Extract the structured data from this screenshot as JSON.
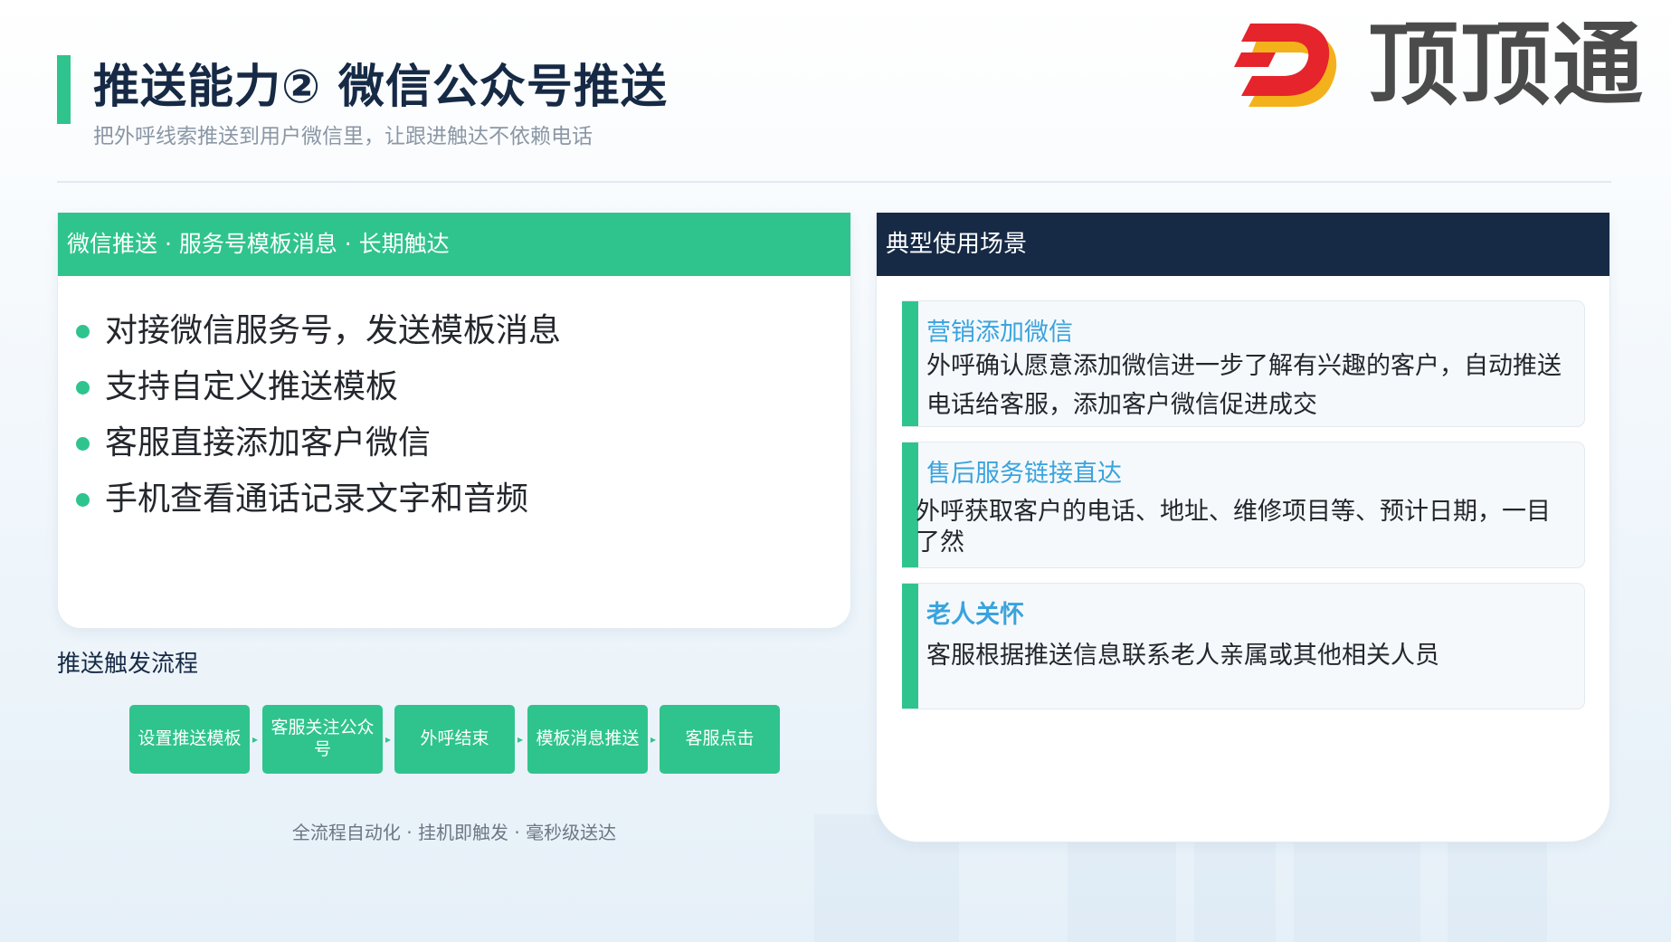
{
  "header": {
    "title": "推送能力② 微信公众号推送",
    "subtitle": "把外呼线索推送到用户微信里，让跟进触达不依赖电话"
  },
  "logo": {
    "text": "顶顶通",
    "icon": "dingdingtong-logo-icon",
    "colors": {
      "red": "#e5242b",
      "yellow": "#f3b21b",
      "text": "#4b4b4b"
    }
  },
  "left_panel": {
    "header": "微信推送 · 服务号模板消息 · 长期触达",
    "features": [
      "对接微信服务号，发送模板消息",
      "支持自定义推送模板",
      "客服直接添加客户微信",
      "手机查看通话记录文字和音频"
    ]
  },
  "flow": {
    "title": "推送触发流程",
    "steps": [
      "设置推送模板",
      "客服关注公众号",
      "外呼结束",
      "模板消息推送",
      "客服点击"
    ],
    "note": "全流程自动化 · 挂机即触发 · 毫秒级送达"
  },
  "right_panel": {
    "header": "典型使用场景",
    "scenarios": [
      {
        "title": "营销添加微信",
        "description": "外呼确认愿意添加微信进一步了解有兴趣的客户，自动推送电话给客服，添加客户微信促进成交"
      },
      {
        "title": "售后服务链接直达",
        "description": "外呼获取客户的电话、地址、维修项目等、预计日期，一目了然"
      },
      {
        "title": "老人关怀",
        "description": "客服根据推送信息联系老人亲属或其他相关人员"
      }
    ]
  },
  "colors": {
    "accent_green": "#2fc48d",
    "navy": "#162a45",
    "scenario_title_blue": "#3aa3de"
  }
}
